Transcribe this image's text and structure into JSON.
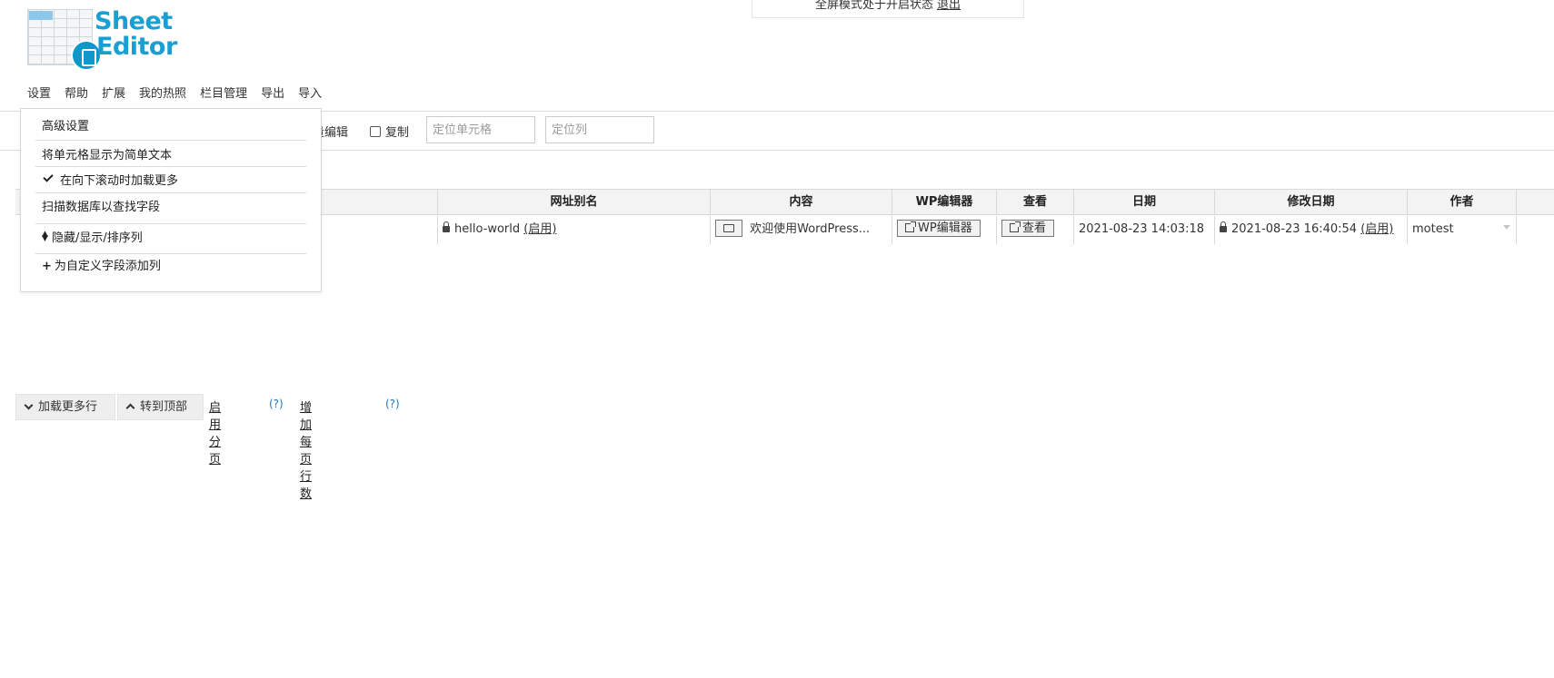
{
  "fullscreen": {
    "text": "全屏模式处于开启状态",
    "exit_label": "退出"
  },
  "logo": {
    "line1": "Sheet",
    "line2": "Editor",
    "brand_color": "#1a9fd3"
  },
  "menu": [
    "设置",
    "帮助",
    "扩展",
    "我的热照",
    "栏目管理",
    "导出",
    "导入"
  ],
  "toolbar": {
    "bulk_edit_label": "量编辑",
    "copy_label": "复制",
    "locate_cell_placeholder": "定位单元格",
    "locate_column_placeholder": "定位列"
  },
  "settings_dropdown": {
    "items": [
      {
        "label": "高级设置",
        "icon": ""
      },
      {
        "label": "将单元格显示为简单文本",
        "icon": ""
      },
      {
        "label": "在向下滚动时加载更多",
        "icon": "check-icon",
        "checked": true
      },
      {
        "label": "扫描数据库以查找字段",
        "icon": ""
      },
      {
        "label": "隐藏/显示/排序列",
        "icon": "sort-icon"
      },
      {
        "label": "为自定义字段添加列",
        "icon": "plus-icon"
      }
    ]
  },
  "table": {
    "columns": [
      "网址别名",
      "内容",
      "WP编辑器",
      "查看",
      "日期",
      "修改日期",
      "作者"
    ],
    "row": {
      "slug": "hello-world",
      "slug_enable": "(启用)",
      "content": "欢迎使用WordPress...",
      "wp_editor_label": "WP编辑器",
      "view_label": "查看",
      "date": "2021-08-23 14:03:18",
      "modified_date": "2021-08-23 16:40:54",
      "modified_enable": "(启用)",
      "author": "motest"
    }
  },
  "pager": {
    "load_more_label": "加载更多行",
    "to_top_label": "转到顶部",
    "enable_pagination_label": "启用分页",
    "help1": "(?)",
    "rows_per_page_label": "增加每页行数",
    "help2": "(?)"
  }
}
